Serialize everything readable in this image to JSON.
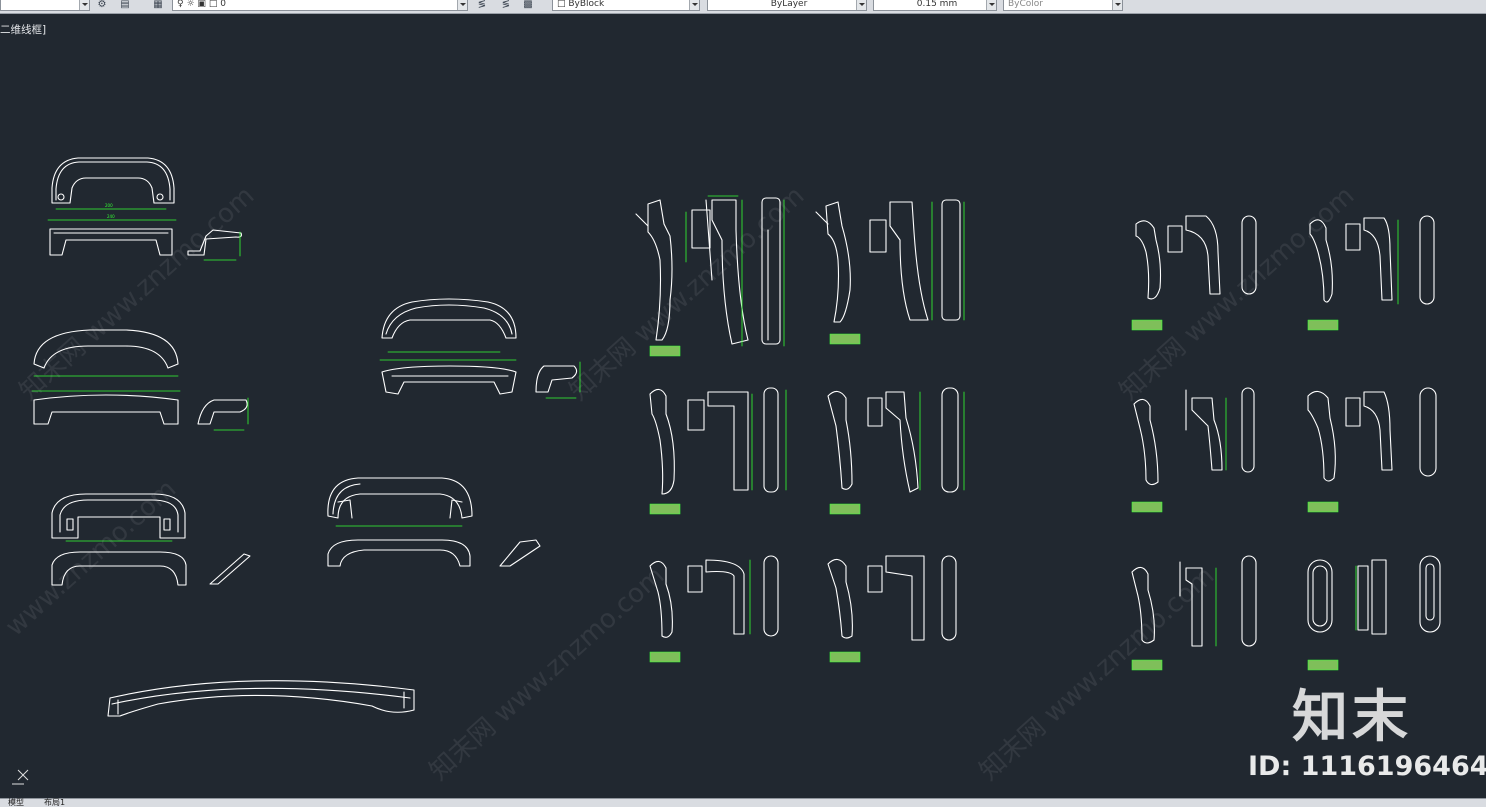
{
  "toolbar": {
    "layer_value": "0",
    "color_value": "ByBlock",
    "linetype_value": "ByLayer",
    "lineweight_value": "0.15 mm",
    "plotstyle_value": "ByColor"
  },
  "viewport": {
    "label": "二维线框]"
  },
  "layout_tabs": {
    "model": "模型",
    "layout1": "布局1"
  },
  "watermark": {
    "site": "www.znzmo.com",
    "site_cn": "知末网",
    "logo": "知末",
    "id_label": "ID: 1116196464"
  },
  "colors": {
    "background": "#212830",
    "geometry": "#ffffff",
    "dimension": "#33ff33",
    "tag_fill": "#7fbf5a",
    "toolbar": "#d9dce1"
  },
  "icons": [
    "layer-icon",
    "lightbulb-icon",
    "sun-icon",
    "lock-icon",
    "color-swatch-icon",
    "match-properties-icon",
    "ucs-icon"
  ]
}
